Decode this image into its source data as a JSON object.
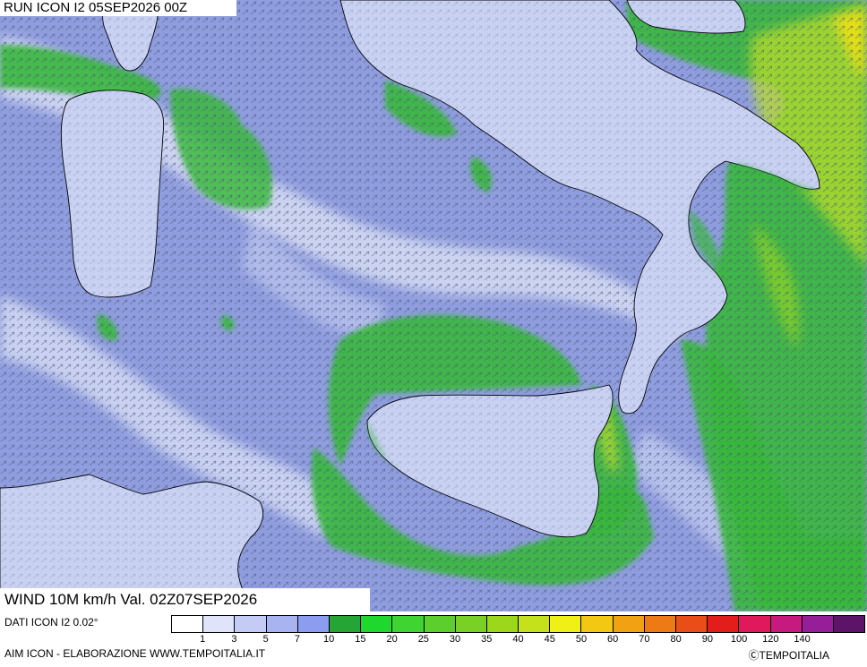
{
  "header": {
    "run_label": "RUN ICON I2 05SEP2026 00Z",
    "wind_label": "WIND 10M km/h Val. 02Z07SEP2026"
  },
  "footer": {
    "data_source": "DATI ICON I2 0.02°",
    "credit": "AIM ICON - ELABORAZIONE WWW.TEMPOITALIA.IT",
    "copyright": "ⒸTEMPOITALIA"
  },
  "legend": {
    "colors": [
      "#ffffff",
      "#dfe4fb",
      "#c4ccf6",
      "#a8b4f2",
      "#8c9cee",
      "#26a537",
      "#1fd82e",
      "#3fd431",
      "#5ccf2e",
      "#7ad126",
      "#9cd71c",
      "#c4e11b",
      "#f0f016",
      "#f2c812",
      "#f1a212",
      "#ed7a15",
      "#ea4e18",
      "#e31c1c",
      "#e0195c",
      "#c71a7e",
      "#951e99",
      "#5c1468"
    ],
    "labels": [
      "1",
      "3",
      "5",
      "7",
      "10",
      "15",
      "20",
      "25",
      "30",
      "35",
      "40",
      "45",
      "50",
      "60",
      "70",
      "80",
      "90",
      "100",
      "120",
      "140"
    ]
  },
  "map": {
    "sea_color": "#8f9ddf",
    "light_band_color": "#d7ddf5",
    "land_color": "#c8d1f2",
    "calm_color": "#ffffff",
    "green_color": "#38b83c",
    "strong_color": "#b8dc2a",
    "coast_color": "#000000",
    "arrow_color": "#55607a"
  }
}
